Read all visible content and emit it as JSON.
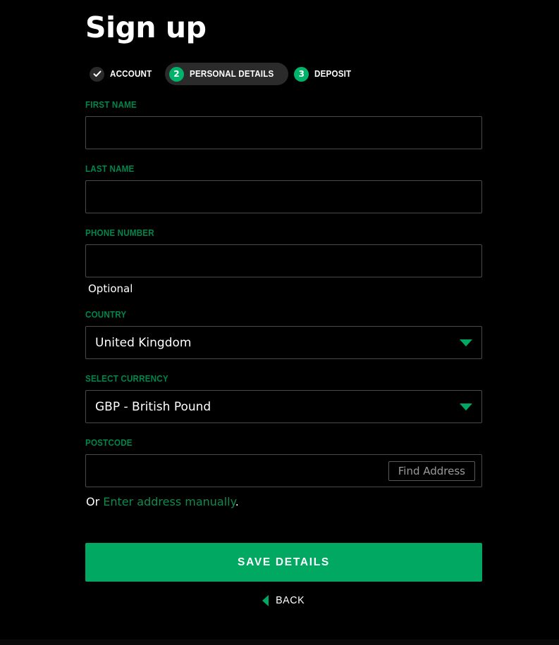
{
  "page": {
    "title": "Sign up"
  },
  "steps": [
    {
      "badge": "check-icon",
      "label": "ACCOUNT",
      "state": "done"
    },
    {
      "badge": "2",
      "label": "PERSONAL DETAILS",
      "state": "active"
    },
    {
      "badge": "3",
      "label": "DEPOSIT",
      "state": "upcoming"
    }
  ],
  "form": {
    "first_name": {
      "label": "FIRST NAME",
      "value": "",
      "placeholder": ""
    },
    "last_name": {
      "label": "LAST NAME",
      "value": "",
      "placeholder": ""
    },
    "phone_number": {
      "label": "PHONE NUMBER",
      "value": "",
      "placeholder": "",
      "helper": "Optional"
    },
    "country": {
      "label": "COUNTRY",
      "value": "United Kingdom"
    },
    "currency": {
      "label": "SELECT CURRENCY",
      "value": "GBP - British Pound"
    },
    "postcode": {
      "label": "POSTCODE",
      "value": "",
      "placeholder": "",
      "find_address_label": "Find Address"
    },
    "manual_address": {
      "prefix": "Or ",
      "link": "Enter address manually",
      "suffix": "."
    }
  },
  "actions": {
    "submit_label": "SAVE DETAILS",
    "back_label": "BACK"
  },
  "colors": {
    "background": "#000000",
    "accent_green": "#00a862",
    "label_green": "#00854b",
    "badge_green": "#00b36b",
    "link_green": "#0f8a4e",
    "input_border": "#4a4a4a",
    "active_pill": "#2b2b2b",
    "done_badge": "#2a2a2a",
    "muted_text": "#9a9a9a"
  }
}
